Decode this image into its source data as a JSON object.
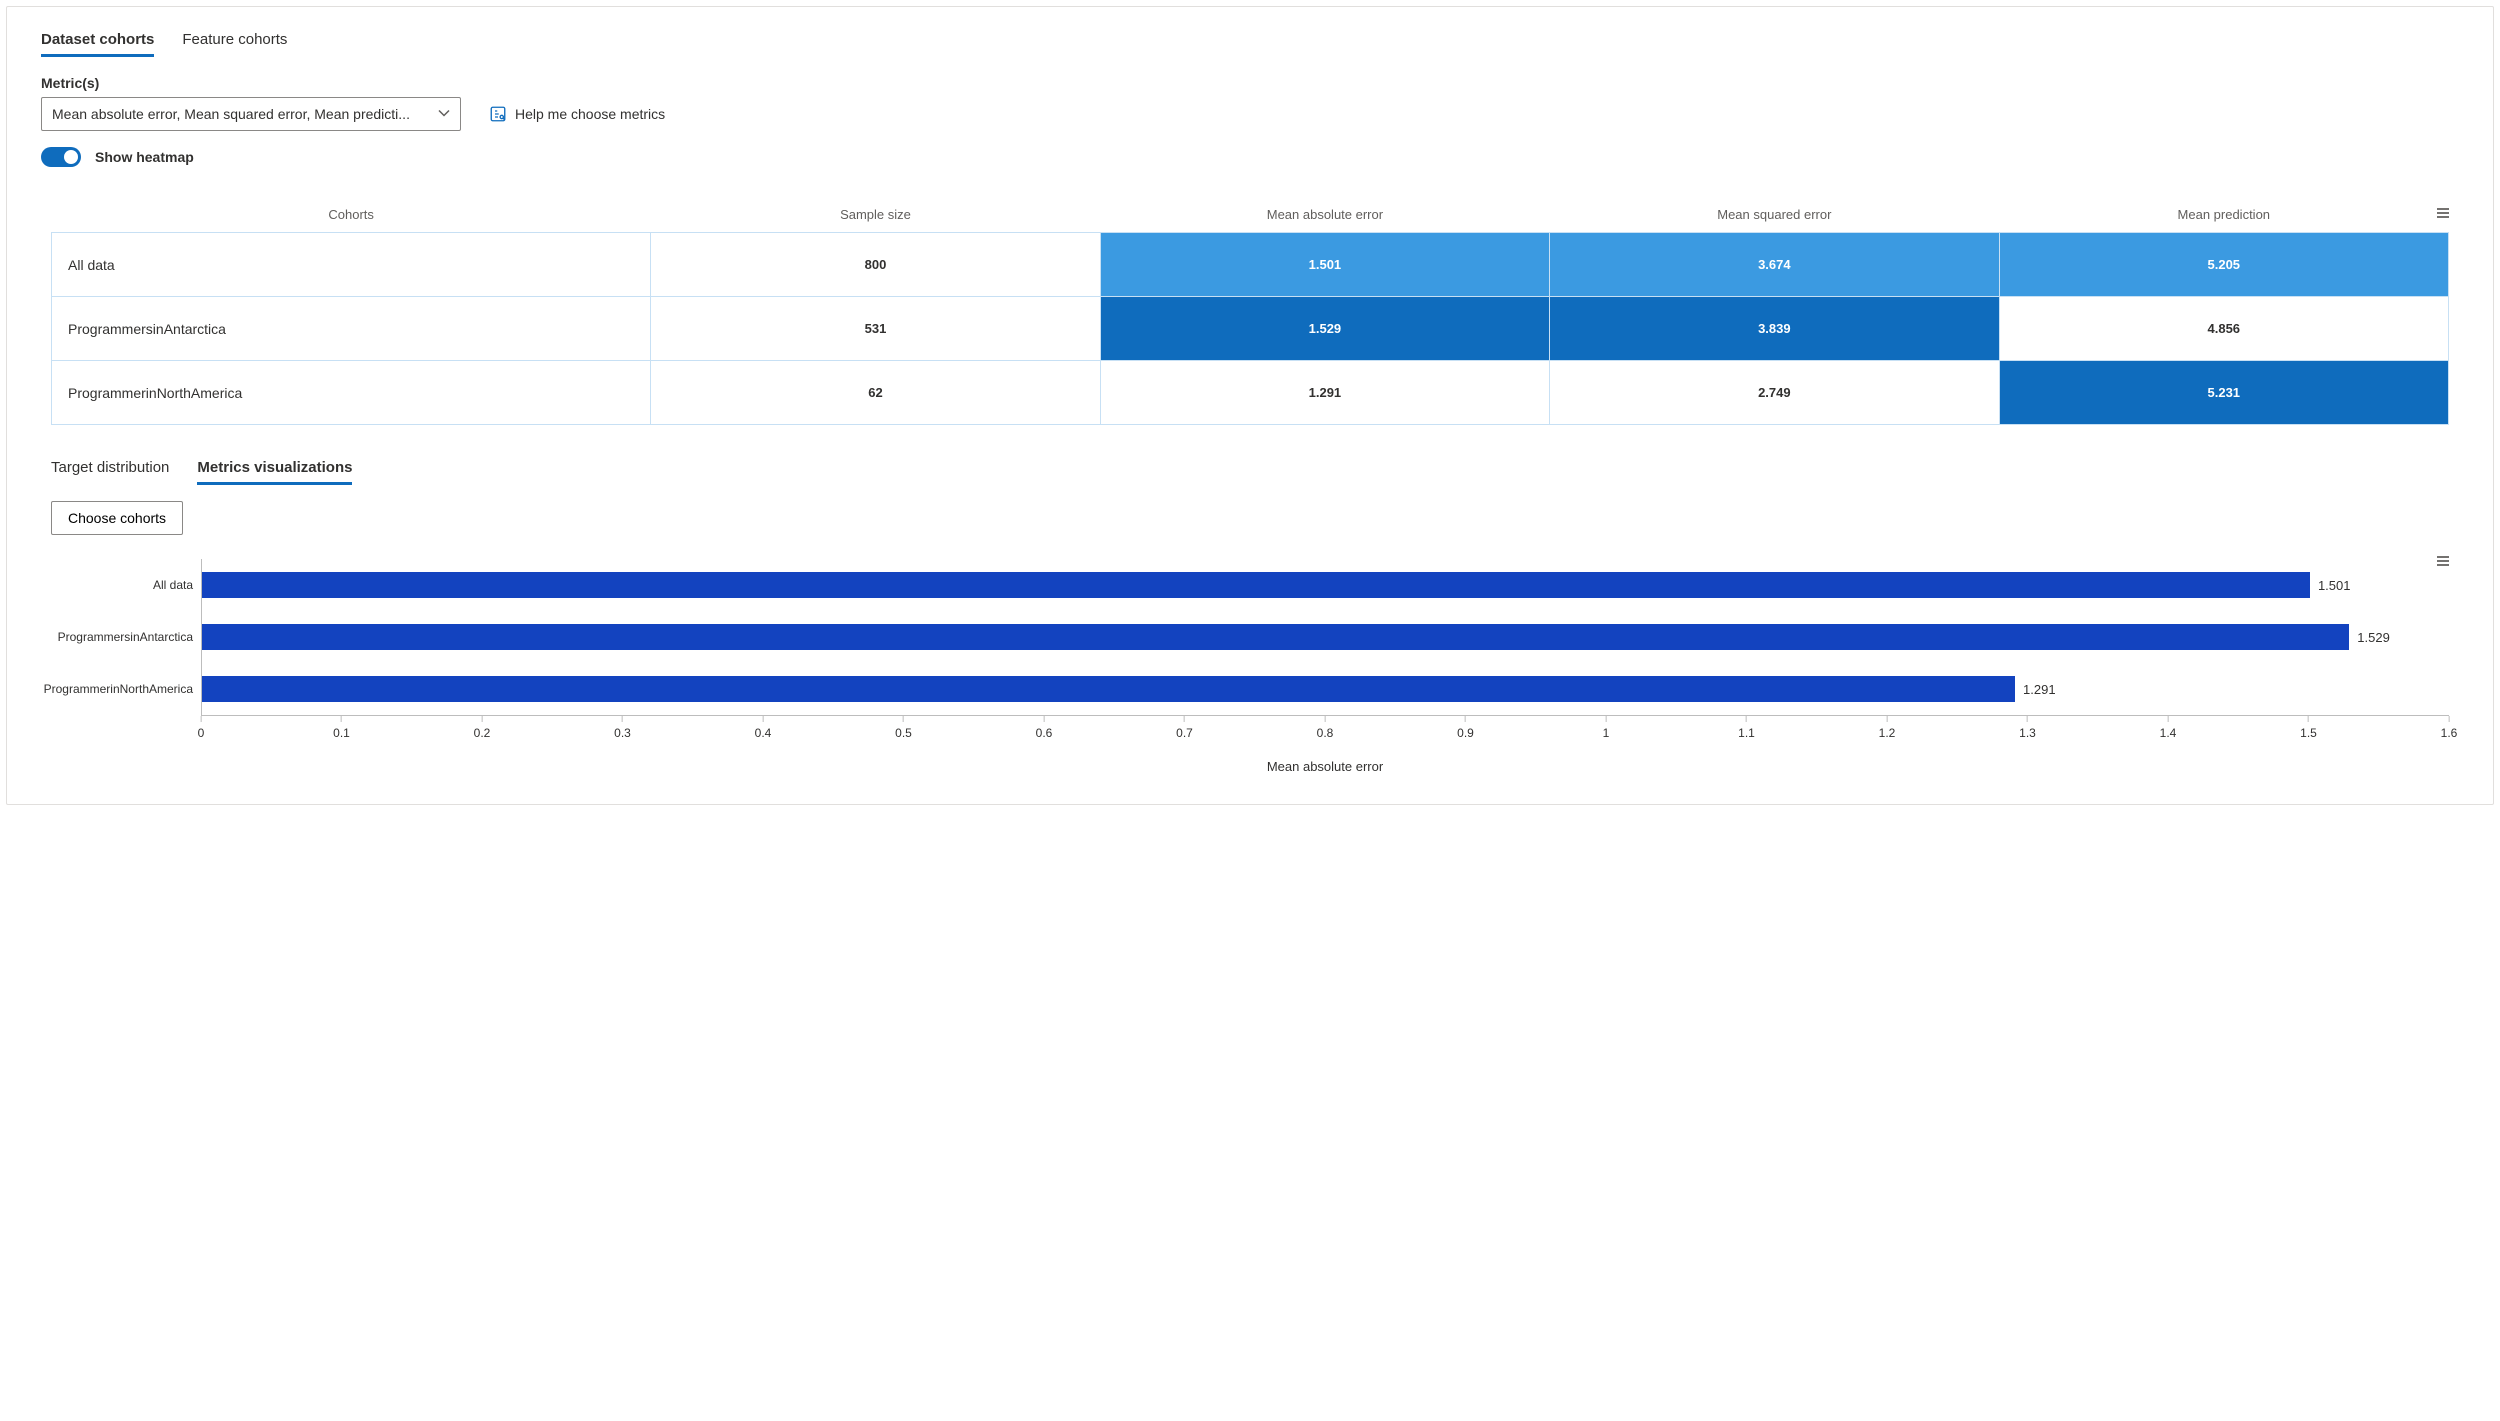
{
  "tabs": {
    "dataset": "Dataset cohorts",
    "feature": "Feature cohorts"
  },
  "metrics": {
    "label": "Metric(s)",
    "dropdown_text": "Mean absolute error, Mean squared error, Mean predicti...",
    "help_text": "Help me choose metrics"
  },
  "toggle": {
    "label": "Show heatmap"
  },
  "table": {
    "headers": {
      "cohorts": "Cohorts",
      "sample": "Sample size",
      "mae": "Mean absolute error",
      "mse": "Mean squared error",
      "pred": "Mean prediction"
    },
    "rows": [
      {
        "name": "All data",
        "sample": "800",
        "mae": "1.501",
        "mse": "3.674",
        "pred": "5.205",
        "cls": {
          "sample": "c-white",
          "mae": "c-light",
          "mse": "c-light",
          "pred": "c-light"
        }
      },
      {
        "name": "ProgrammersinAntarctica",
        "sample": "531",
        "mae": "1.529",
        "mse": "3.839",
        "pred": "4.856",
        "cls": {
          "sample": "c-white",
          "mae": "c-dark",
          "mse": "c-dark",
          "pred": "c-white"
        }
      },
      {
        "name": "ProgrammerinNorthAmerica",
        "sample": "62",
        "mae": "1.291",
        "mse": "2.749",
        "pred": "5.231",
        "cls": {
          "sample": "c-white",
          "mae": "c-white",
          "mse": "c-white",
          "pred": "c-dark"
        }
      }
    ]
  },
  "subtabs": {
    "target": "Target distribution",
    "metrics": "Metrics visualizations"
  },
  "choose_button": "Choose cohorts",
  "chart_data": {
    "type": "bar",
    "orientation": "horizontal",
    "categories": [
      "All data",
      "ProgrammersinAntarctica",
      "ProgrammerinNorthAmerica"
    ],
    "values": [
      1.501,
      1.529,
      1.291
    ],
    "xlabel": "Mean absolute error",
    "xlim": [
      0,
      1.6
    ],
    "ticks": [
      0,
      0.1,
      0.2,
      0.3,
      0.4,
      0.5,
      0.6,
      0.7,
      0.8,
      0.9,
      1,
      1.1,
      1.2,
      1.3,
      1.4,
      1.5,
      1.6
    ]
  }
}
